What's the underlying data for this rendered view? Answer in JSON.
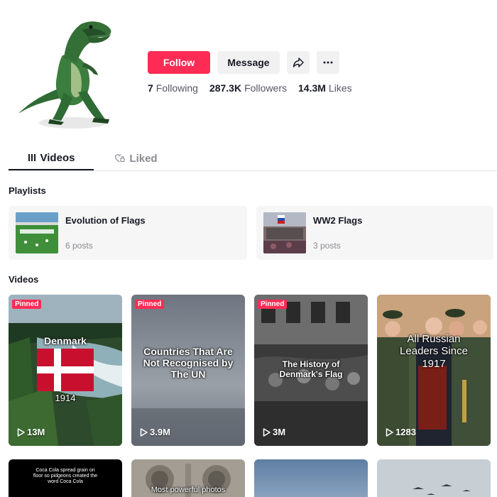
{
  "profile": {
    "follow_label": "Follow",
    "message_label": "Message",
    "share_icon": "share-icon",
    "more_icon": "more-icon",
    "following_count": "7",
    "following_label": "Following",
    "followers_count": "287.3K",
    "followers_label": "Followers",
    "likes_count": "14.3M",
    "likes_label": "Likes"
  },
  "tabs": [
    {
      "label": "Videos",
      "icon": "grid-icon"
    },
    {
      "label": "Liked",
      "icon": "heart-lock-icon"
    }
  ],
  "sections": {
    "playlists_title": "Playlists",
    "videos_title": "Videos"
  },
  "playlists": [
    {
      "name": "Evolution of Flags",
      "posts": "6 posts"
    },
    {
      "name": "WW2 Flags",
      "posts": "3 posts"
    }
  ],
  "videos": [
    {
      "pinned": "Pinned",
      "title": "Denmark",
      "subtitle": "1914",
      "views": "13M"
    },
    {
      "pinned": "Pinned",
      "title": "Countries That Are Not Recognised by The UN",
      "views": "3.9M"
    },
    {
      "pinned": "Pinned",
      "title": "The History of Denmark's Flag",
      "views": "3M"
    },
    {
      "title": "All Russian Leaders Since 1917",
      "views": "1283"
    },
    {
      "title": "Coca Cola spread grain on floor so pidgeons created the word Coca Cola"
    },
    {
      "title": "Most powerful photos"
    }
  ],
  "colors": {
    "accent": "#fe2c55",
    "button_gray": "#f1f1f2",
    "text_secondary": "#8a8b91"
  }
}
